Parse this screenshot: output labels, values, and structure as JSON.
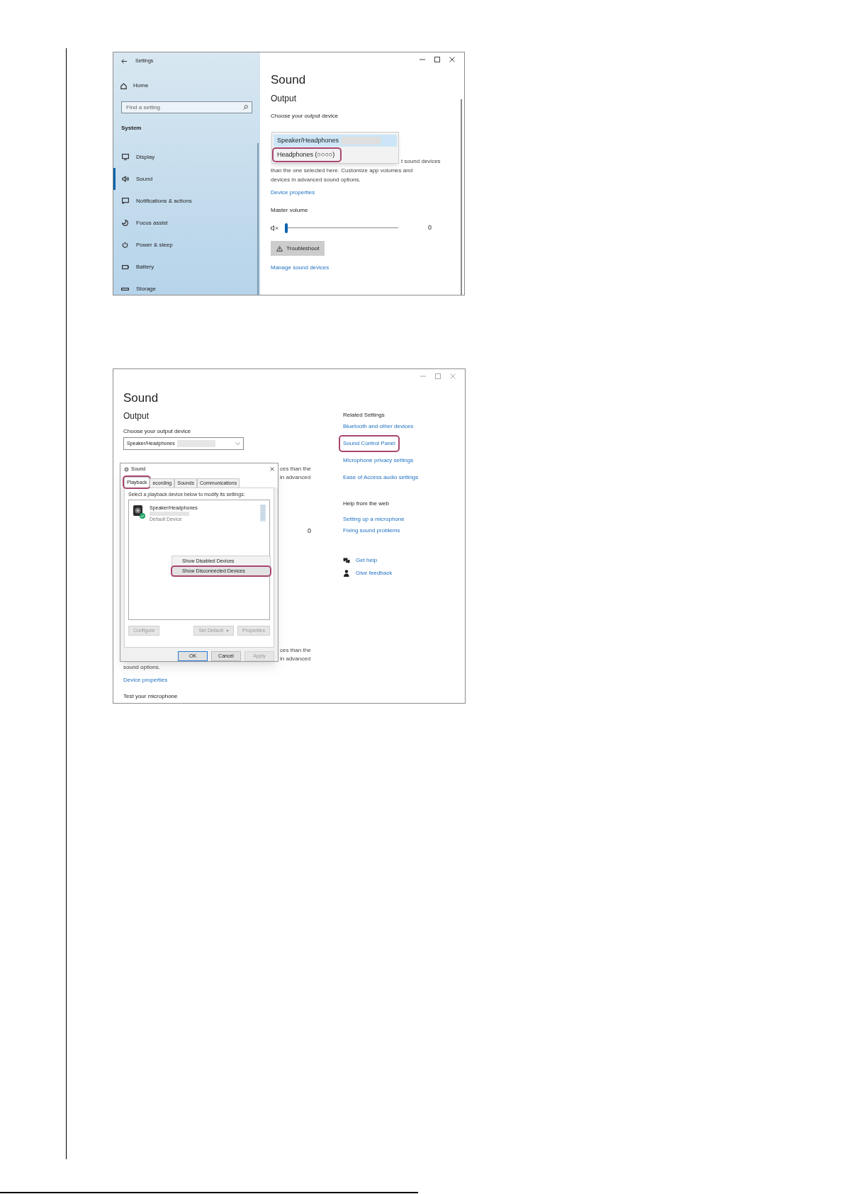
{
  "screenshot_1": {
    "sidebar": {
      "title": "Settings",
      "home": "Home",
      "search": {
        "placeholder": "Find a setting"
      },
      "section": "System",
      "items": [
        {
          "label": "Display",
          "kind": "display",
          "selected": false
        },
        {
          "label": "Sound",
          "kind": "sound",
          "selected": true
        },
        {
          "label": "Notifications & actions",
          "kind": "notifications",
          "selected": false
        },
        {
          "label": "Focus assist",
          "kind": "focus",
          "selected": false
        },
        {
          "label": "Power & sleep",
          "kind": "power",
          "selected": false
        },
        {
          "label": "Battery",
          "kind": "battery",
          "selected": false
        },
        {
          "label": "Storage",
          "kind": "storage",
          "selected": false
        }
      ]
    },
    "page_title": "Sound",
    "section": "Output",
    "device_label": "Choose your output device",
    "dropdown_options": [
      {
        "label": "Speaker/Headphones",
        "selected": true,
        "highlighted": false
      },
      {
        "label": "Headphones (○○○○)",
        "selected": false,
        "highlighted": true
      }
    ],
    "description_lines": [
      "t sound devices",
      "than the one selected here. Customize app volumes and",
      "devices in advanced sound options."
    ],
    "device_properties_link": "Device properties",
    "master_volume": {
      "label": "Master volume",
      "level": 0,
      "reading": "0"
    },
    "troubleshoot_button": "Troubleshoot",
    "manage_link": "Manage sound devices"
  },
  "screenshot_2": {
    "page_title": "Sound",
    "section": "Output",
    "device_label": "Choose your output device",
    "device_select": "Speaker/Headphones",
    "fragments_top": [
      "ces than the",
      "in advanced"
    ],
    "volume_reading": "0",
    "fragments_bottom": [
      "ces than the",
      "in advanced"
    ],
    "description_end": "sound options.",
    "device_properties_link": "Device properties",
    "test_heading": "Test your microphone",
    "related": {
      "heading": "Related Settings",
      "links": [
        {
          "label": "Bluetooth and other devices",
          "highlighted": false
        },
        {
          "label": "Sound Control Panel",
          "highlighted": true
        },
        {
          "label": "Microphone privacy settings",
          "highlighted": false
        },
        {
          "label": "Ease of Access audio settings",
          "highlighted": false
        }
      ]
    },
    "help": {
      "heading": "Help from the web",
      "links": [
        "Setting up a microphone",
        "Fixing sound problems"
      ]
    },
    "actions": [
      {
        "label": "Get help",
        "kind": "help"
      },
      {
        "label": "Give feedback",
        "kind": "feedback"
      }
    ],
    "dialog": {
      "title": "Sound",
      "tabs": [
        {
          "label": "Playback",
          "selected": true,
          "highlighted": true
        },
        {
          "label": "ecording",
          "selected": false,
          "highlighted": false
        },
        {
          "label": "Sounds",
          "selected": false,
          "highlighted": false
        },
        {
          "label": "Communications",
          "selected": false,
          "highlighted": false
        }
      ],
      "instruction": "Select a playback device below to modify its settings:",
      "devices": [
        {
          "name": "Speaker/Headphones",
          "status": "Default Device",
          "default": true
        }
      ],
      "context_menu": [
        {
          "label": "Show Disabled Devices",
          "highlighted": false
        },
        {
          "label": "Show Disconnected Devices",
          "highlighted": true
        }
      ],
      "buttons": [
        {
          "label": "Configure",
          "kind": "plain",
          "disabled": true
        },
        {
          "label": "Set Default",
          "kind": "split",
          "disabled": true
        },
        {
          "label": "Properties",
          "kind": "plain",
          "disabled": true
        }
      ],
      "footer_buttons": [
        {
          "label": "OK",
          "disabled": false,
          "default": true
        },
        {
          "label": "Cancel",
          "disabled": false,
          "default": false
        },
        {
          "label": "Apply",
          "disabled": true,
          "default": false
        }
      ]
    }
  }
}
